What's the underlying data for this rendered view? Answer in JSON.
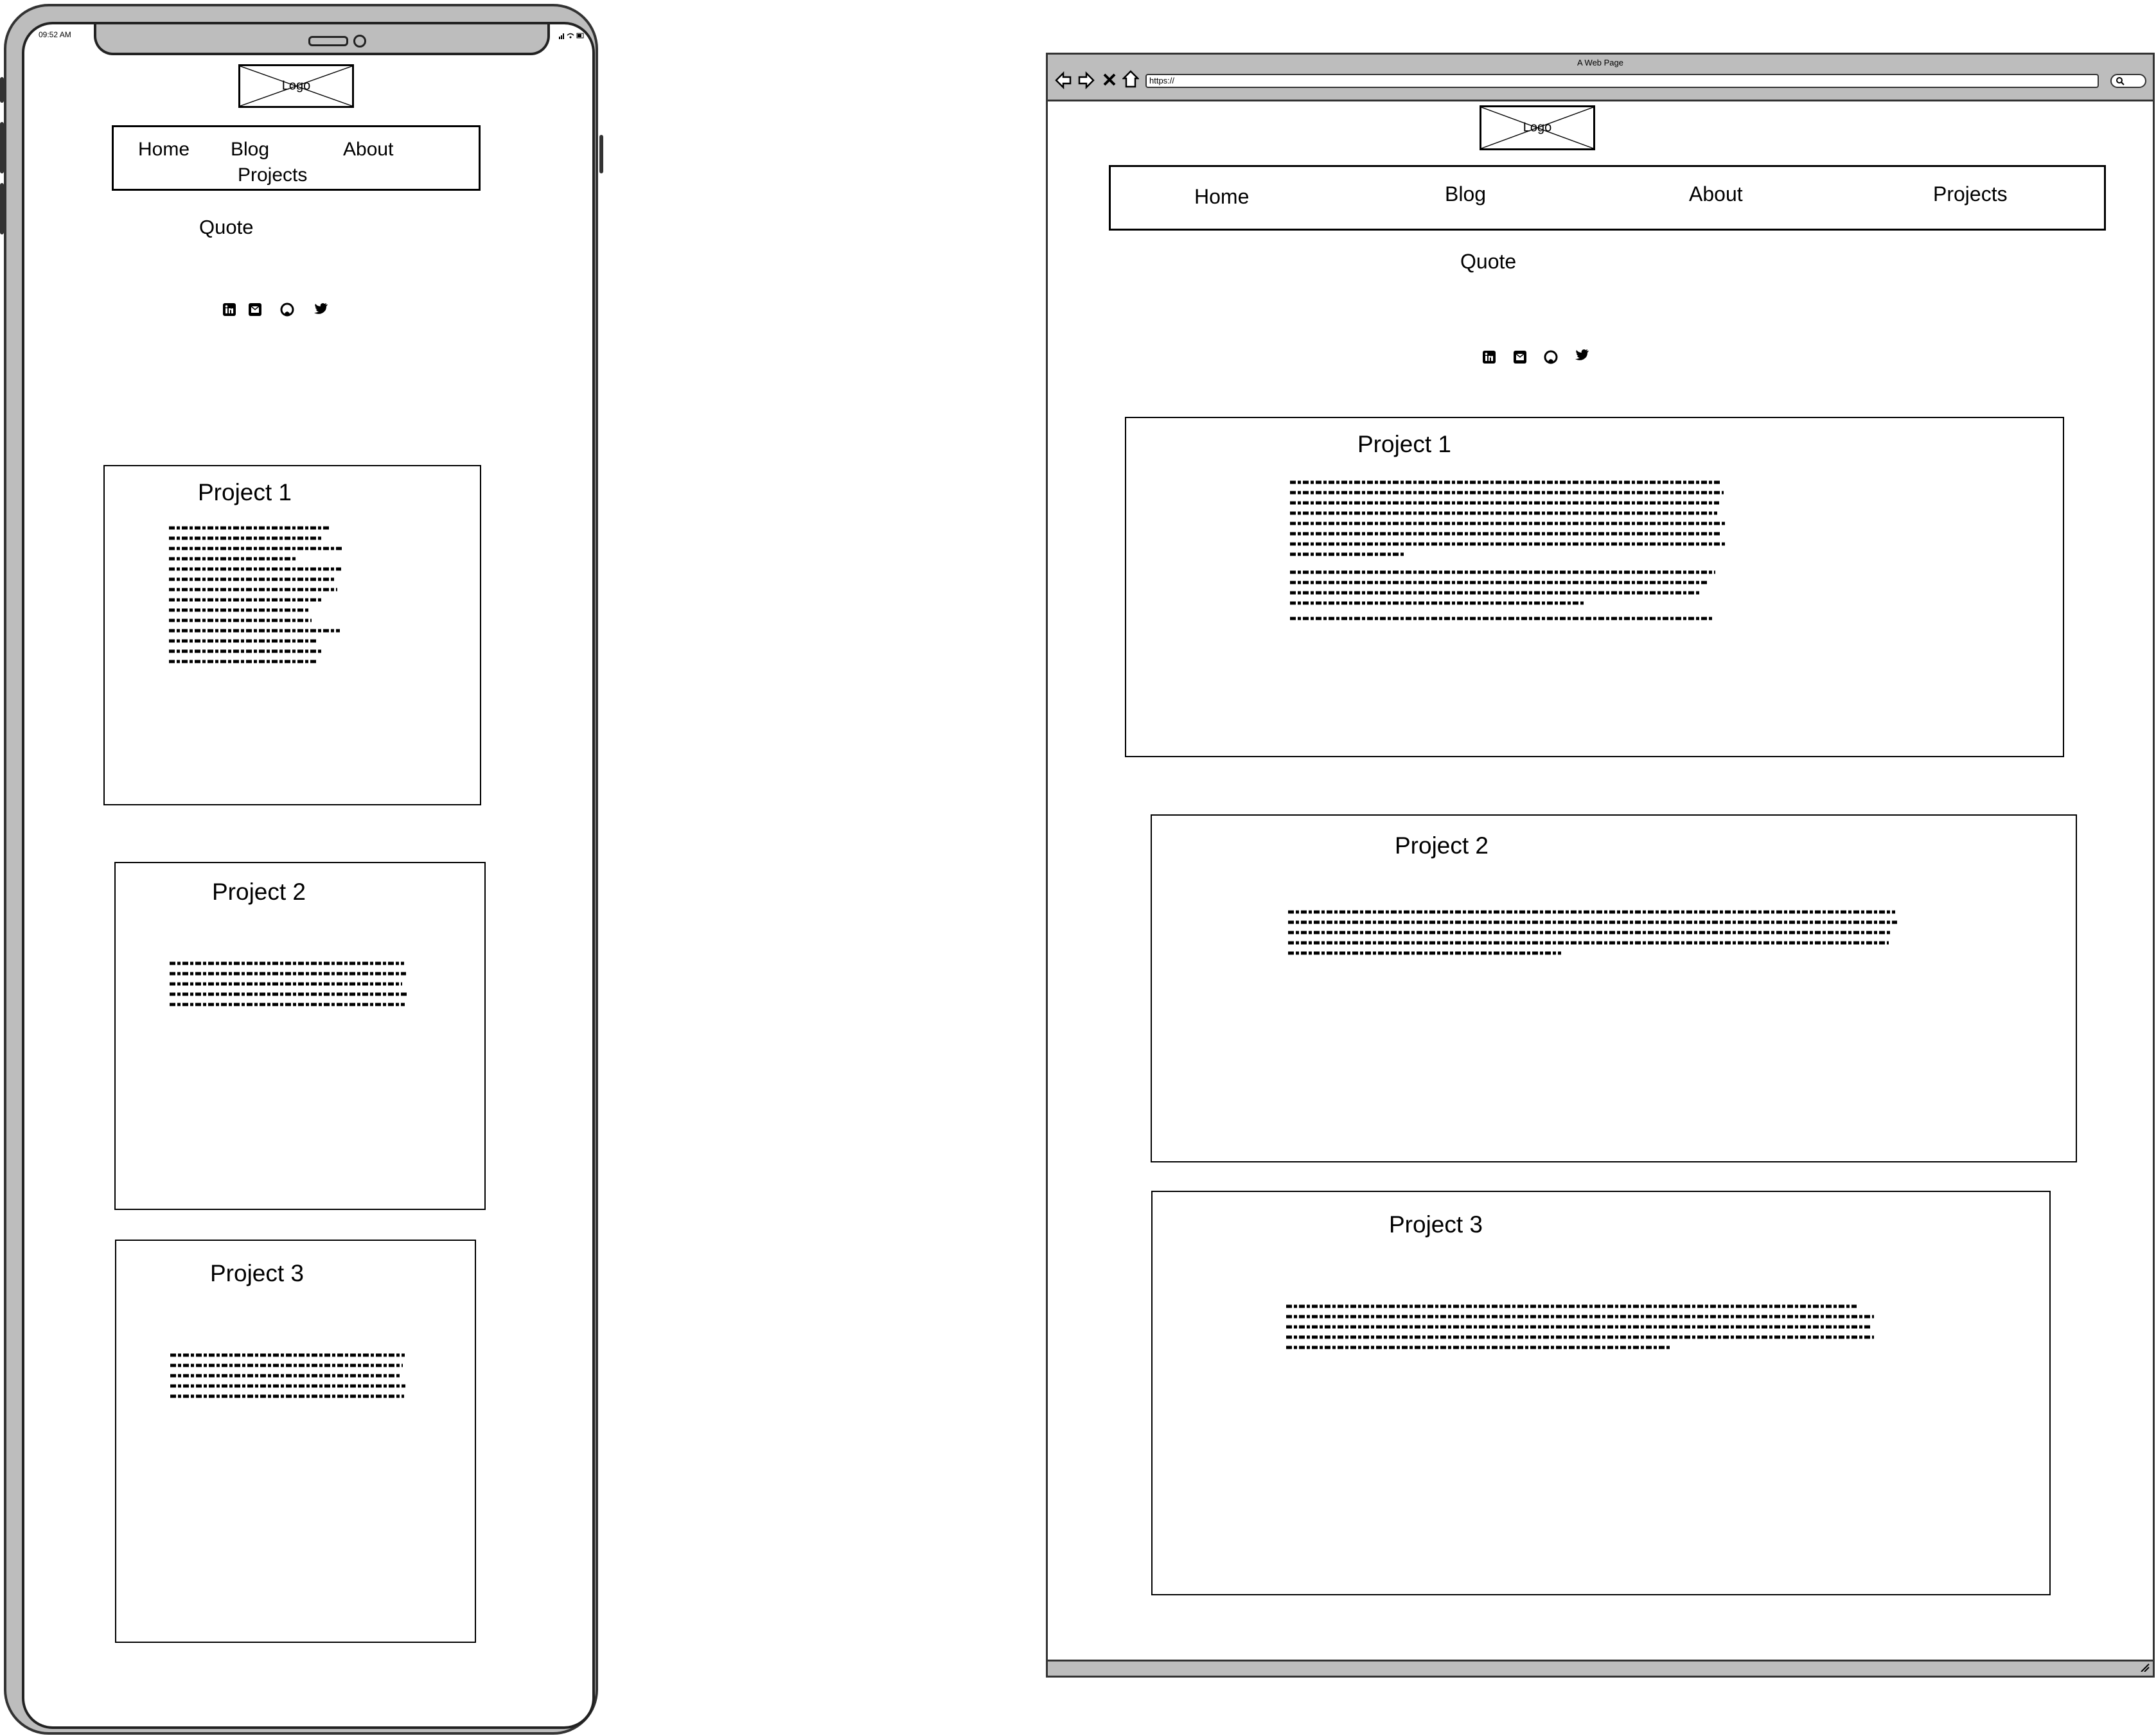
{
  "phone": {
    "status_time": "09:52 AM",
    "logo": "Logo",
    "nav": [
      "Home",
      "Blog",
      "About",
      "Projects"
    ],
    "quote": "Quote",
    "social_icons": [
      "linkedin-icon",
      "email-icon",
      "github-icon",
      "twitter-icon"
    ],
    "projects": [
      {
        "title": "Project 1"
      },
      {
        "title": "Project 2"
      },
      {
        "title": "Project 3"
      }
    ]
  },
  "browser": {
    "title": "A Web Page",
    "url": "https://",
    "logo": "Logo",
    "nav": [
      "Home",
      "Blog",
      "About",
      "Projects"
    ],
    "quote": "Quote",
    "social_icons": [
      "linkedin-icon",
      "email-icon",
      "github-icon",
      "twitter-icon"
    ],
    "projects": [
      {
        "title": "Project 1"
      },
      {
        "title": "Project 2"
      },
      {
        "title": "Project 3"
      }
    ]
  }
}
